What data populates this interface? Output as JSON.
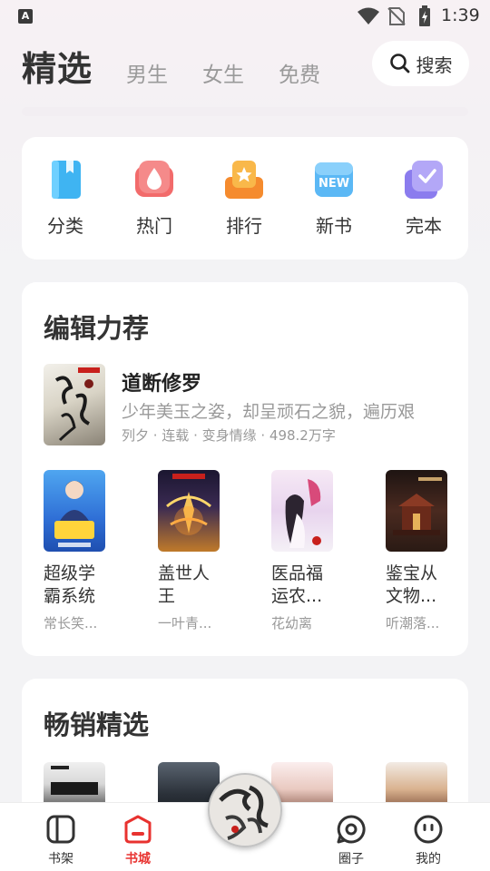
{
  "status_bar": {
    "time": "1:39",
    "icons": [
      "a-icon",
      "wifi-icon",
      "no-sim-icon",
      "battery-icon"
    ]
  },
  "header": {
    "title": "精选",
    "tabs": [
      "男生",
      "女生",
      "免费"
    ],
    "search_label": "搜索"
  },
  "categories": [
    {
      "label": "分类",
      "icon": "category-book-icon",
      "color": "#3fb4f2"
    },
    {
      "label": "热门",
      "icon": "hot-drop-icon",
      "color": "#f26b6b"
    },
    {
      "label": "排行",
      "icon": "rank-star-icon",
      "color": "#f7a13c"
    },
    {
      "label": "新书",
      "icon": "new-badge-icon",
      "color": "#5bb8f5"
    },
    {
      "label": "完本",
      "icon": "complete-check-icon",
      "color": "#9c8cf0"
    }
  ],
  "editor_picks": {
    "title": "编辑力荐",
    "featured": {
      "title": "道断修罗",
      "description": "少年美玉之姿，却呈顽石之貌，遍历艰",
      "meta": "列夕 · 连载 · 变身情缘 · 498.2万字"
    },
    "books": [
      {
        "title": "超级学霸系统",
        "author": "常长笑..."
      },
      {
        "title": "盖世人王",
        "author": "一叶青..."
      },
      {
        "title": "医品福运农...",
        "author": "花幼离"
      },
      {
        "title": "鉴宝从文物...",
        "author": "听潮落..."
      }
    ]
  },
  "bestsellers": {
    "title": "畅销精选"
  },
  "tabbar": {
    "items": [
      {
        "label": "书架",
        "icon": "bookshelf-icon"
      },
      {
        "label": "书城",
        "icon": "bookstore-icon",
        "active": true
      },
      {
        "label": "圈子",
        "icon": "circle-community-icon"
      },
      {
        "label": "我的",
        "icon": "profile-face-icon"
      }
    ],
    "colors": {
      "active": "#e8322f",
      "inactive": "#333333"
    }
  }
}
